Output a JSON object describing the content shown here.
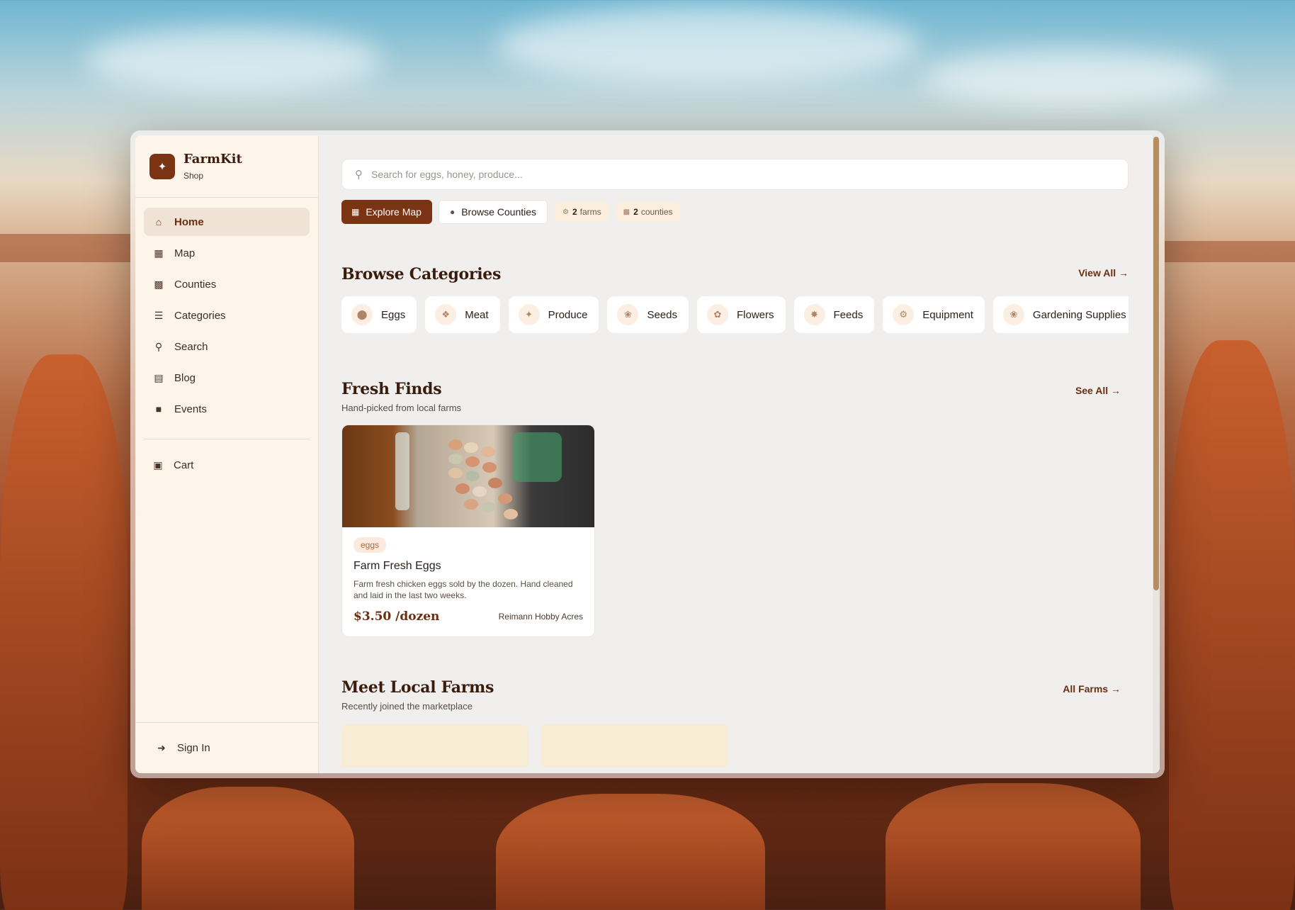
{
  "brand": {
    "name": "FarmKit",
    "subtitle": "Shop",
    "logo_icon": "carrot-icon"
  },
  "nav": {
    "items": [
      {
        "label": "Home",
        "icon": "home-icon",
        "active": true
      },
      {
        "label": "Map",
        "icon": "map-icon"
      },
      {
        "label": "Counties",
        "icon": "county-map-icon"
      },
      {
        "label": "Categories",
        "icon": "layers-icon"
      },
      {
        "label": "Search",
        "icon": "search-icon"
      },
      {
        "label": "Blog",
        "icon": "newspaper-icon"
      },
      {
        "label": "Events",
        "icon": "calendar-icon"
      }
    ],
    "cart": {
      "label": "Cart",
      "icon": "cart-icon"
    },
    "signin": {
      "label": "Sign In",
      "icon": "sign-in-icon"
    }
  },
  "search": {
    "placeholder": "Search for eggs, honey, produce..."
  },
  "quick_actions": {
    "explore_map": "Explore Map",
    "browse_counties": "Browse Counties",
    "farms_count": "2",
    "farms_label": "farms",
    "counties_count": "2",
    "counties_label": "counties"
  },
  "categories": {
    "title": "Browse Categories",
    "link": "View All →",
    "items": [
      {
        "label": "Eggs",
        "icon": "egg-icon"
      },
      {
        "label": "Meat",
        "icon": "drumstick-icon"
      },
      {
        "label": "Produce",
        "icon": "carrot-icon"
      },
      {
        "label": "Seeds",
        "icon": "seedling-icon"
      },
      {
        "label": "Flowers",
        "icon": "flower-icon"
      },
      {
        "label": "Feeds",
        "icon": "wheat-icon"
      },
      {
        "label": "Equipment",
        "icon": "tractor-icon"
      },
      {
        "label": "Gardening Supplies",
        "icon": "seedling-icon"
      }
    ]
  },
  "fresh_finds": {
    "title": "Fresh Finds",
    "subtitle": "Hand-picked from local farms",
    "link": "See All →",
    "products": [
      {
        "tag": "eggs",
        "title": "Farm Fresh Eggs",
        "description": "Farm fresh chicken eggs sold by the dozen. Hand cleaned and laid in the last two weeks.",
        "price": "$3.50 /dozen",
        "farm": "Reimann Hobby Acres"
      }
    ]
  },
  "local_farms": {
    "title": "Meet Local Farms",
    "subtitle": "Recently joined the marketplace",
    "link": "All Farms →"
  },
  "colors": {
    "accent": "#7a3414",
    "sidebar_bg": "#fdf5ea",
    "main_bg": "#f0efee"
  }
}
